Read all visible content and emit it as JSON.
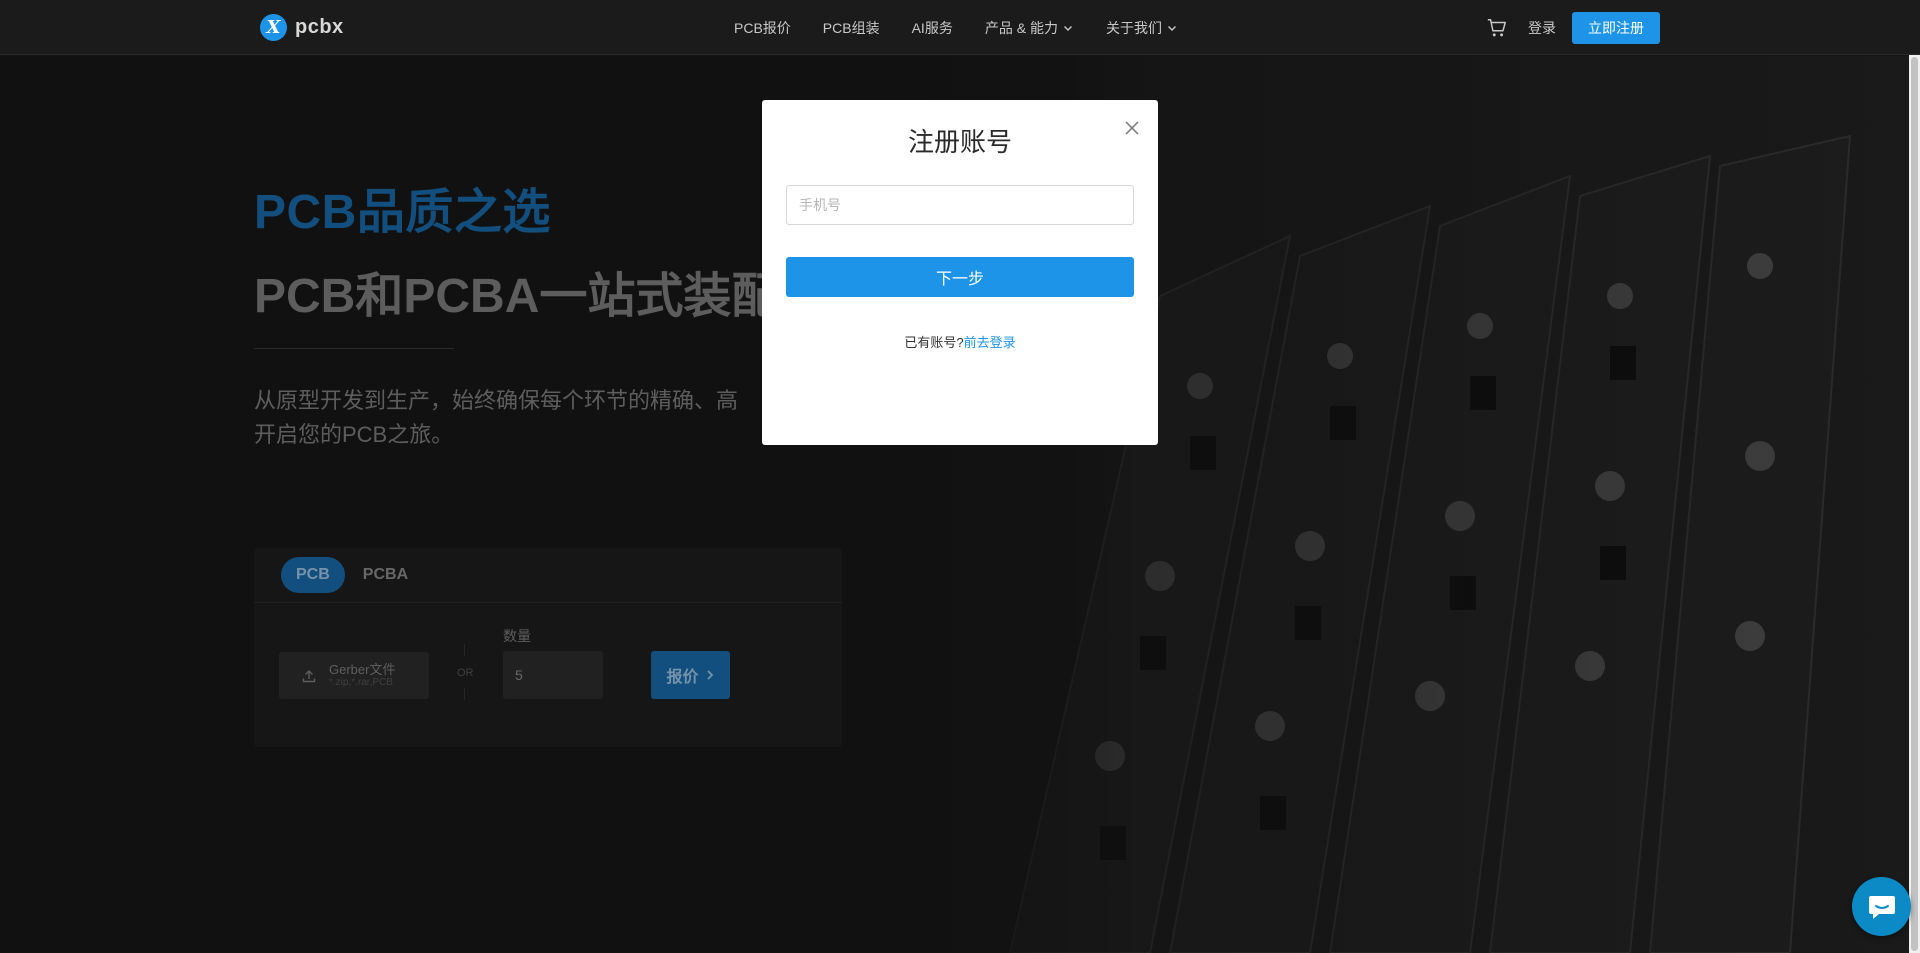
{
  "header": {
    "logo_mark": "X",
    "logo_text": "pcbx",
    "nav": [
      {
        "label": "PCB报价",
        "has_dropdown": false
      },
      {
        "label": "PCB组装",
        "has_dropdown": false
      },
      {
        "label": "AI服务",
        "has_dropdown": false
      },
      {
        "label": "产品 & 能力",
        "has_dropdown": true
      },
      {
        "label": "关于我们",
        "has_dropdown": true
      }
    ],
    "cart_icon": "shopping-cart-icon",
    "login_label": "登录",
    "register_label": "立即注册"
  },
  "hero": {
    "title": "PCB品质之选",
    "subtitle": "PCB和PCBA一站式装配",
    "description_line1": "从原型开发到生产，始终确保每个环节的精确、高",
    "description_line2": "开启您的PCB之旅。"
  },
  "quote": {
    "tabs": [
      {
        "label": "PCB",
        "active": true
      },
      {
        "label": "PCBA",
        "active": false
      }
    ],
    "upload_title": "Gerber文件",
    "upload_hint": "*.zip,*.rar,PCB",
    "or_label": "OR",
    "quantity_label": "数量",
    "quantity_value": "5",
    "quote_button": "报价"
  },
  "modal": {
    "title": "注册账号",
    "phone_placeholder": "手机号",
    "next_button": "下一步",
    "has_account_text": "已有账号?",
    "login_link": "前去登录"
  },
  "colors": {
    "accent": "#1e94e8",
    "hero_title": "#1a6aa8",
    "header_bg": "#1b1b1b"
  }
}
